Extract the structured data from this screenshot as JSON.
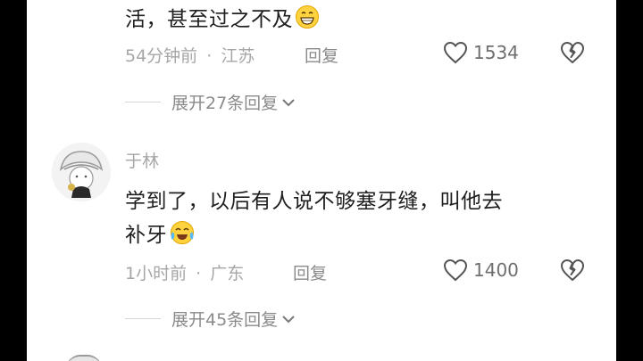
{
  "comments": [
    {
      "text_lines": [
        "活，甚至过之不及"
      ],
      "time": "54分钟前",
      "location": "江苏",
      "reply_label": "回复",
      "likes": "1534",
      "expand_label": "展开27条回复"
    },
    {
      "username": "于林",
      "text_lines": [
        "学到了，以后有人说不够塞牙缝，叫他去",
        "补牙"
      ],
      "time": "1小时前",
      "location": "广东",
      "reply_label": "回复",
      "likes": "1400",
      "expand_label": "展开45条回复"
    }
  ],
  "separator": "·",
  "colors": {
    "background": "#ffffff",
    "frame": "#000000",
    "meta": "#a6a6a6",
    "text": "#1f1f1f"
  }
}
